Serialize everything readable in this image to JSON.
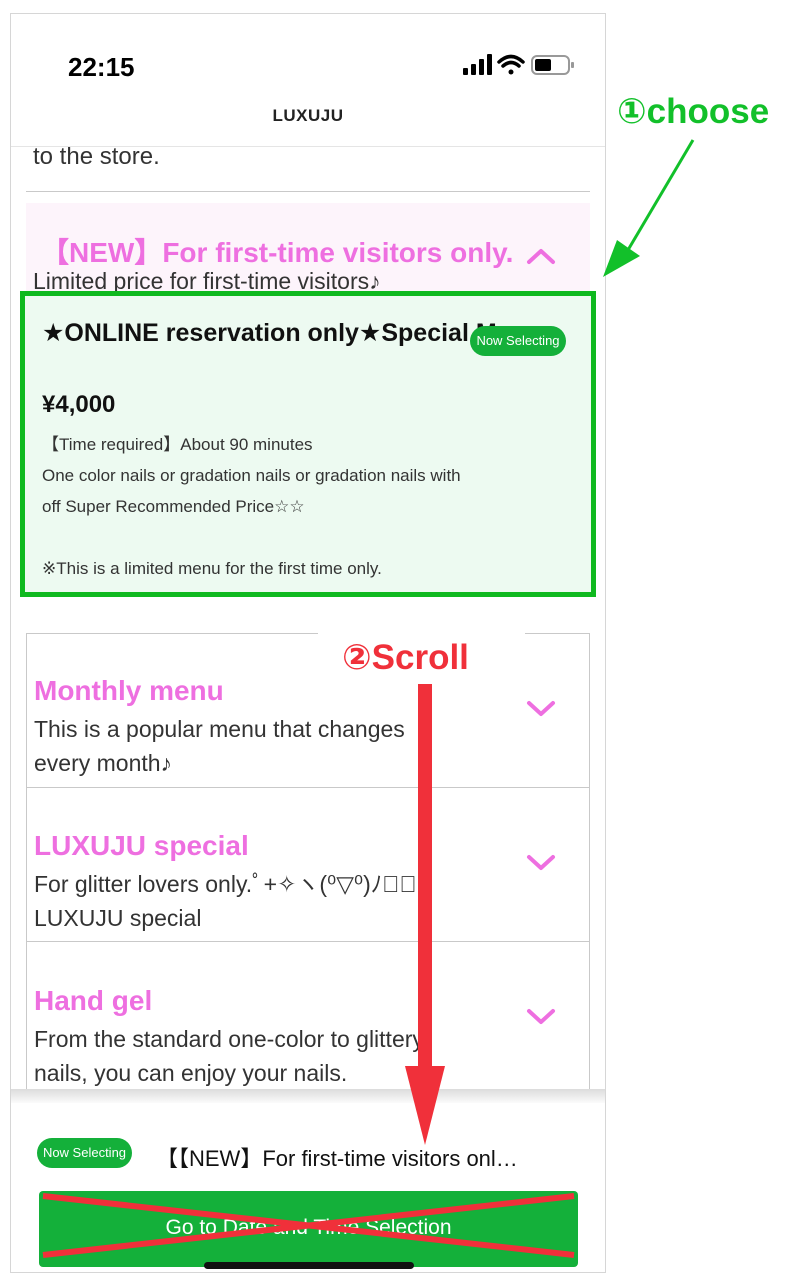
{
  "status_bar": {
    "time": "22:15"
  },
  "nav": {
    "title": "LUXUJU"
  },
  "list": {
    "previous_text": "to the store.",
    "open_category": {
      "title": "【NEW】For first-time visitors only.",
      "description": "Limited price for first-time visitors♪"
    },
    "selected_menu": {
      "name": "★ONLINE reservation only★Special Menu",
      "badge": "Now Selecting",
      "price": "¥4,000",
      "time_required": "【Time required】About 90 minutes",
      "description_line1": "One color nails or gradation nails or gradation nails with",
      "description_line2": "off Super Recommended Price☆☆",
      "note": "※This is a limited menu for the first time only."
    },
    "categories": [
      {
        "title": "Monthly menu",
        "line1": "This is a popular menu that changes",
        "line2": "every month♪"
      },
      {
        "title": "LUXUJU special",
        "line1": "For glitter lovers only.ﾟ+✧ヽ(⁰▽⁰)ﾉ✧ﾟ",
        "line2": "LUXUJU special"
      },
      {
        "title": "Hand gel",
        "line1": "From the standard one-color to glittery",
        "line2": "nails, you can enjoy your nails."
      }
    ]
  },
  "footer": {
    "badge": "Now Selecting",
    "selected_summary": "【【NEW】For first-time visitors onl…",
    "button_label": "Go to Date and Time Selection"
  },
  "annotations": {
    "step1": "①choose",
    "step2": "②Scroll"
  },
  "colors": {
    "accent_pink": "#ee6fe0",
    "green": "#14b03a",
    "annotation_green": "#12c02a",
    "annotation_red": "#f0303a"
  }
}
